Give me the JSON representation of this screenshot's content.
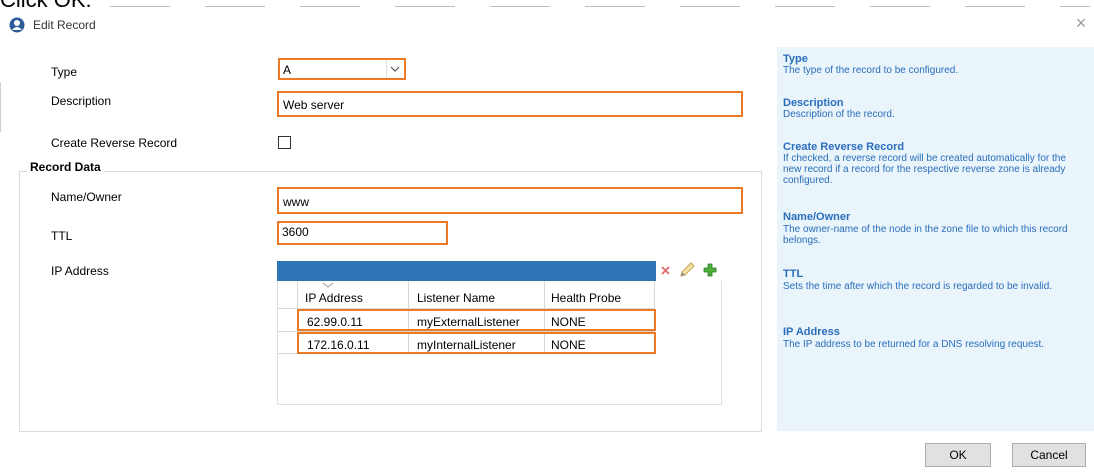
{
  "caption": "Click OK.",
  "window": {
    "title": "Edit Record"
  },
  "form": {
    "type_label": "Type",
    "type_value": "A",
    "description_label": "Description",
    "description_value": "Web server",
    "reverse_label": "Create Reverse Record",
    "reverse_checked": false,
    "record_data_title": "Record Data",
    "name_label": "Name/Owner",
    "name_value": "www",
    "ttl_label": "TTL",
    "ttl_value": "3600",
    "ip_label": "IP Address"
  },
  "grid": {
    "columns": [
      "IP Address",
      "Listener Name",
      "Health Probe"
    ],
    "rows": [
      [
        "62.99.0.11",
        "myExternalListener",
        "NONE"
      ],
      [
        "172.16.0.11",
        "myInternalListener",
        "NONE"
      ]
    ]
  },
  "help": [
    {
      "title": "Type",
      "desc": "The type of the record to be configured."
    },
    {
      "title": "Description",
      "desc": "Description of the record."
    },
    {
      "title": "Create Reverse Record",
      "desc": "If checked, a reverse record will be created automatically for the new record if a record for the respective reverse zone is already configured."
    },
    {
      "title": "Name/Owner",
      "desc": "The owner-name of the node in the zone file to which this record belongs."
    },
    {
      "title": "TTL",
      "desc": "Sets the time after which the record is regarded to be invalid."
    },
    {
      "title": "IP Address",
      "desc": "The IP address to be returned for a DNS resolving request."
    }
  ],
  "buttons": {
    "ok": "OK",
    "cancel": "Cancel"
  },
  "colors": {
    "highlight": "#ea7a24",
    "grid_header": "#2e75b6",
    "help_bg": "#e9f4fb",
    "help_text": "#2a6ebb"
  },
  "icons": [
    "app-icon",
    "close-icon",
    "delete-icon",
    "edit-icon",
    "add-icon",
    "chevron-down-icon",
    "sort-indicator-icon"
  ]
}
